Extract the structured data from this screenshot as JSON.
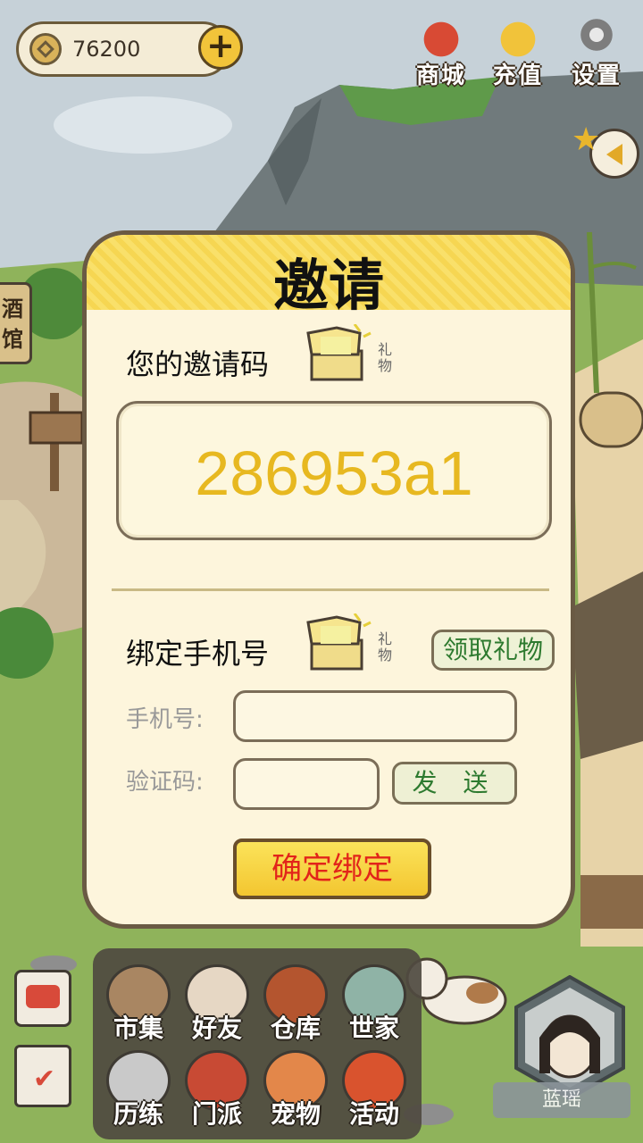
{
  "currency": {
    "amount": "76200"
  },
  "top_menu": [
    {
      "label": "商城",
      "icon": "bag-icon"
    },
    {
      "label": "充值",
      "icon": "gold-ingot-icon"
    },
    {
      "label": "设置",
      "icon": "gear-icon"
    }
  ],
  "side": {
    "tavern_label": "酒馆"
  },
  "modal": {
    "title": "邀请",
    "invite_label": "您的邀请码",
    "gift_tag": "礼物",
    "invite_code": "286953a1",
    "bind_label": "绑定手机号",
    "gift_tag2": "礼物",
    "claim_button": "领取礼物",
    "phone_label": "手机号:",
    "phone_value": "",
    "code_label": "验证码:",
    "code_value": "",
    "send_button": "发 送",
    "confirm_button": "确定绑定"
  },
  "bottom_menu": [
    {
      "label": "市集",
      "icon": "market-icon"
    },
    {
      "label": "好友",
      "icon": "handshake-icon"
    },
    {
      "label": "仓库",
      "icon": "chest-icon"
    },
    {
      "label": "世家",
      "icon": "house-icon"
    },
    {
      "label": "历练",
      "icon": "swords-icon"
    },
    {
      "label": "门派",
      "icon": "banner-icon"
    },
    {
      "label": "宠物",
      "icon": "paw-icon"
    },
    {
      "label": "活动",
      "icon": "lantern-icon"
    }
  ],
  "player": {
    "name": "蓝瑶"
  },
  "colors": {
    "code": "#e7b820",
    "confirm_text": "#e2241a",
    "green_text": "#2d7a2f"
  }
}
